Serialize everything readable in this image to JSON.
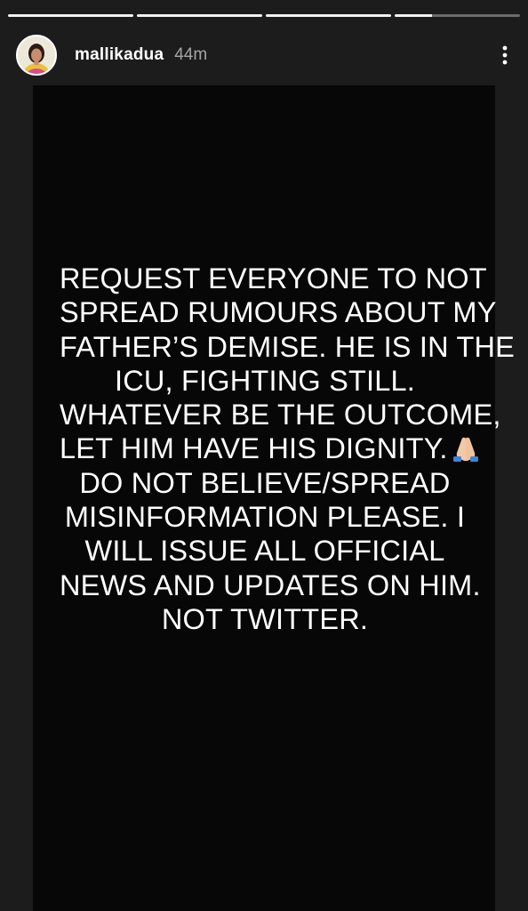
{
  "story": {
    "progress_segments": [
      {
        "fill_percent": 100
      },
      {
        "fill_percent": 100
      },
      {
        "fill_percent": 100
      },
      {
        "fill_percent": 30
      }
    ],
    "author": {
      "username": "mallikadua",
      "time_ago": "44m",
      "avatar_icon": "profile-avatar"
    },
    "more_icon": "more-vertical-icon",
    "message_lines": [
      "REQUEST EVERYONE TO NOT",
      "SPREAD RUMOURS ABOUT MY",
      "FATHER’S DEMISE. HE IS IN THE",
      "ICU, FIGHTING STILL.",
      "WHATEVER BE THE OUTCOME,",
      "LET HIM HAVE HIS DIGNITY.",
      "DO NOT BELIEVE/SPREAD",
      "MISINFORMATION PLEASE. I",
      "WILL ISSUE ALL OFFICIAL",
      "NEWS AND UPDATES ON HIM.",
      "NOT TWITTER."
    ],
    "emoji": "folded-hands-emoji",
    "colors": {
      "background": "#1c1c1c",
      "card": "#070707",
      "text": "#ffffff"
    }
  }
}
